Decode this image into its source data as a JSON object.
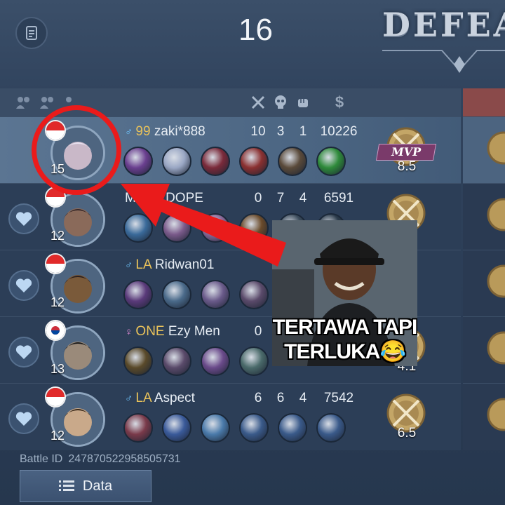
{
  "header": {
    "menu_icon": "clipboard-list-icon",
    "score": "16",
    "result": "DEFEA"
  },
  "column_icons": [
    "swords-kills-icon",
    "skull-deaths-icon",
    "fist-assists-icon",
    "gold-dollar-icon"
  ],
  "players": [
    {
      "flag": "indonesia",
      "level": "15",
      "gender": "♂",
      "tag": "99",
      "name": "zaki*888",
      "kills": "10",
      "deaths": "3",
      "assists": "1",
      "gold": "10226",
      "medal": "MVP",
      "score": "8.5",
      "highlight": true,
      "item_colors": [
        "#6a3f8f",
        "#9aa7c4",
        "#7a2a3a",
        "#8a3030",
        "#5a4a3a",
        "#2e8a3a"
      ]
    },
    {
      "flag": "indonesia",
      "level": "12",
      "gender": "",
      "tag": "",
      "name": "Mad ft DOPE",
      "kills": "0",
      "deaths": "7",
      "assists": "4",
      "gold": "6591",
      "medal": "",
      "score": "",
      "highlight": false,
      "item_colors": [
        "#3a6a9a",
        "#7a5a8a",
        "#8a6a9a",
        "#6a4a2a",
        "#3a4a5a",
        "#2a3a4a"
      ]
    },
    {
      "flag": "indonesia",
      "level": "12",
      "gender": "♂",
      "tag": "LA",
      "name": "Ridwan01",
      "kills": "",
      "deaths": "",
      "assists": "",
      "gold": "",
      "medal": "",
      "score": "",
      "highlight": false,
      "item_colors": [
        "#5a3a7a",
        "#4a6a8a",
        "#6a5a8a",
        "#5a4a6a"
      ]
    },
    {
      "flag": "korea",
      "level": "13",
      "gender": "♀",
      "tag": "ONE",
      "name": "Ezy Men",
      "kills": "0",
      "deaths": "",
      "assists": "",
      "gold": "",
      "medal": "",
      "score": "4.1",
      "highlight": false,
      "item_colors": [
        "#5a4a2a",
        "#5a4a6a",
        "#6a4a8a",
        "#4a6a6a"
      ]
    },
    {
      "flag": "indonesia",
      "level": "12",
      "gender": "♂",
      "tag": "LA",
      "name": "Aspect",
      "kills": "6",
      "deaths": "6",
      "assists": "4",
      "gold": "7542",
      "medal": "",
      "score": "6.5",
      "highlight": false,
      "item_colors": [
        "#7a3a4a",
        "#3a5a9a",
        "#4a7aaa",
        "#3a5a8a",
        "#3a5a8a",
        "#3a5a8a"
      ]
    }
  ],
  "footer": {
    "battle_id_label": "Battle ID",
    "battle_id": "247870522958505731",
    "data_button": "Data",
    "data_icon": "list-icon"
  },
  "meme": {
    "caption_line1": "TERTAWA TAPI",
    "caption_line2": "TERLUKA😂"
  },
  "annotation": {
    "color": "#ea1b1b"
  }
}
